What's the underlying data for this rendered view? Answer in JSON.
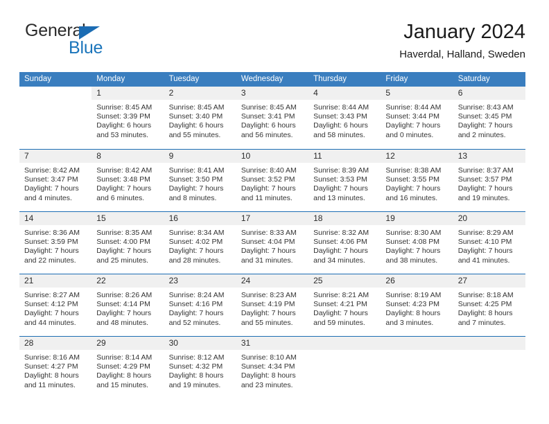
{
  "brand": {
    "name_part1": "General",
    "name_part2": "Blue",
    "color_primary": "#1b75bb",
    "color_text": "#2b2b2b"
  },
  "header": {
    "title": "January 2024",
    "subtitle": "Haverdal, Halland, Sweden"
  },
  "calendar": {
    "header_bg": "#3a7ebf",
    "daynum_bg": "#f0f0f0",
    "weekdays": [
      "Sunday",
      "Monday",
      "Tuesday",
      "Wednesday",
      "Thursday",
      "Friday",
      "Saturday"
    ],
    "weeks": [
      {
        "accent": false,
        "days": [
          {
            "num": "",
            "lines": []
          },
          {
            "num": "1",
            "lines": [
              "Sunrise: 8:45 AM",
              "Sunset: 3:39 PM",
              "Daylight: 6 hours",
              "and 53 minutes."
            ]
          },
          {
            "num": "2",
            "lines": [
              "Sunrise: 8:45 AM",
              "Sunset: 3:40 PM",
              "Daylight: 6 hours",
              "and 55 minutes."
            ]
          },
          {
            "num": "3",
            "lines": [
              "Sunrise: 8:45 AM",
              "Sunset: 3:41 PM",
              "Daylight: 6 hours",
              "and 56 minutes."
            ]
          },
          {
            "num": "4",
            "lines": [
              "Sunrise: 8:44 AM",
              "Sunset: 3:43 PM",
              "Daylight: 6 hours",
              "and 58 minutes."
            ]
          },
          {
            "num": "5",
            "lines": [
              "Sunrise: 8:44 AM",
              "Sunset: 3:44 PM",
              "Daylight: 7 hours",
              "and 0 minutes."
            ]
          },
          {
            "num": "6",
            "lines": [
              "Sunrise: 8:43 AM",
              "Sunset: 3:45 PM",
              "Daylight: 7 hours",
              "and 2 minutes."
            ]
          }
        ]
      },
      {
        "accent": true,
        "days": [
          {
            "num": "7",
            "lines": [
              "Sunrise: 8:42 AM",
              "Sunset: 3:47 PM",
              "Daylight: 7 hours",
              "and 4 minutes."
            ]
          },
          {
            "num": "8",
            "lines": [
              "Sunrise: 8:42 AM",
              "Sunset: 3:48 PM",
              "Daylight: 7 hours",
              "and 6 minutes."
            ]
          },
          {
            "num": "9",
            "lines": [
              "Sunrise: 8:41 AM",
              "Sunset: 3:50 PM",
              "Daylight: 7 hours",
              "and 8 minutes."
            ]
          },
          {
            "num": "10",
            "lines": [
              "Sunrise: 8:40 AM",
              "Sunset: 3:52 PM",
              "Daylight: 7 hours",
              "and 11 minutes."
            ]
          },
          {
            "num": "11",
            "lines": [
              "Sunrise: 8:39 AM",
              "Sunset: 3:53 PM",
              "Daylight: 7 hours",
              "and 13 minutes."
            ]
          },
          {
            "num": "12",
            "lines": [
              "Sunrise: 8:38 AM",
              "Sunset: 3:55 PM",
              "Daylight: 7 hours",
              "and 16 minutes."
            ]
          },
          {
            "num": "13",
            "lines": [
              "Sunrise: 8:37 AM",
              "Sunset: 3:57 PM",
              "Daylight: 7 hours",
              "and 19 minutes."
            ]
          }
        ]
      },
      {
        "accent": true,
        "days": [
          {
            "num": "14",
            "lines": [
              "Sunrise: 8:36 AM",
              "Sunset: 3:59 PM",
              "Daylight: 7 hours",
              "and 22 minutes."
            ]
          },
          {
            "num": "15",
            "lines": [
              "Sunrise: 8:35 AM",
              "Sunset: 4:00 PM",
              "Daylight: 7 hours",
              "and 25 minutes."
            ]
          },
          {
            "num": "16",
            "lines": [
              "Sunrise: 8:34 AM",
              "Sunset: 4:02 PM",
              "Daylight: 7 hours",
              "and 28 minutes."
            ]
          },
          {
            "num": "17",
            "lines": [
              "Sunrise: 8:33 AM",
              "Sunset: 4:04 PM",
              "Daylight: 7 hours",
              "and 31 minutes."
            ]
          },
          {
            "num": "18",
            "lines": [
              "Sunrise: 8:32 AM",
              "Sunset: 4:06 PM",
              "Daylight: 7 hours",
              "and 34 minutes."
            ]
          },
          {
            "num": "19",
            "lines": [
              "Sunrise: 8:30 AM",
              "Sunset: 4:08 PM",
              "Daylight: 7 hours",
              "and 38 minutes."
            ]
          },
          {
            "num": "20",
            "lines": [
              "Sunrise: 8:29 AM",
              "Sunset: 4:10 PM",
              "Daylight: 7 hours",
              "and 41 minutes."
            ]
          }
        ]
      },
      {
        "accent": true,
        "days": [
          {
            "num": "21",
            "lines": [
              "Sunrise: 8:27 AM",
              "Sunset: 4:12 PM",
              "Daylight: 7 hours",
              "and 44 minutes."
            ]
          },
          {
            "num": "22",
            "lines": [
              "Sunrise: 8:26 AM",
              "Sunset: 4:14 PM",
              "Daylight: 7 hours",
              "and 48 minutes."
            ]
          },
          {
            "num": "23",
            "lines": [
              "Sunrise: 8:24 AM",
              "Sunset: 4:16 PM",
              "Daylight: 7 hours",
              "and 52 minutes."
            ]
          },
          {
            "num": "24",
            "lines": [
              "Sunrise: 8:23 AM",
              "Sunset: 4:19 PM",
              "Daylight: 7 hours",
              "and 55 minutes."
            ]
          },
          {
            "num": "25",
            "lines": [
              "Sunrise: 8:21 AM",
              "Sunset: 4:21 PM",
              "Daylight: 7 hours",
              "and 59 minutes."
            ]
          },
          {
            "num": "26",
            "lines": [
              "Sunrise: 8:19 AM",
              "Sunset: 4:23 PM",
              "Daylight: 8 hours",
              "and 3 minutes."
            ]
          },
          {
            "num": "27",
            "lines": [
              "Sunrise: 8:18 AM",
              "Sunset: 4:25 PM",
              "Daylight: 8 hours",
              "and 7 minutes."
            ]
          }
        ]
      },
      {
        "accent": true,
        "days": [
          {
            "num": "28",
            "lines": [
              "Sunrise: 8:16 AM",
              "Sunset: 4:27 PM",
              "Daylight: 8 hours",
              "and 11 minutes."
            ]
          },
          {
            "num": "29",
            "lines": [
              "Sunrise: 8:14 AM",
              "Sunset: 4:29 PM",
              "Daylight: 8 hours",
              "and 15 minutes."
            ]
          },
          {
            "num": "30",
            "lines": [
              "Sunrise: 8:12 AM",
              "Sunset: 4:32 PM",
              "Daylight: 8 hours",
              "and 19 minutes."
            ]
          },
          {
            "num": "31",
            "lines": [
              "Sunrise: 8:10 AM",
              "Sunset: 4:34 PM",
              "Daylight: 8 hours",
              "and 23 minutes."
            ]
          },
          {
            "num": "",
            "lines": [],
            "shaded": true
          },
          {
            "num": "",
            "lines": [],
            "shaded": true
          },
          {
            "num": "",
            "lines": [],
            "shaded": true
          }
        ]
      }
    ]
  }
}
